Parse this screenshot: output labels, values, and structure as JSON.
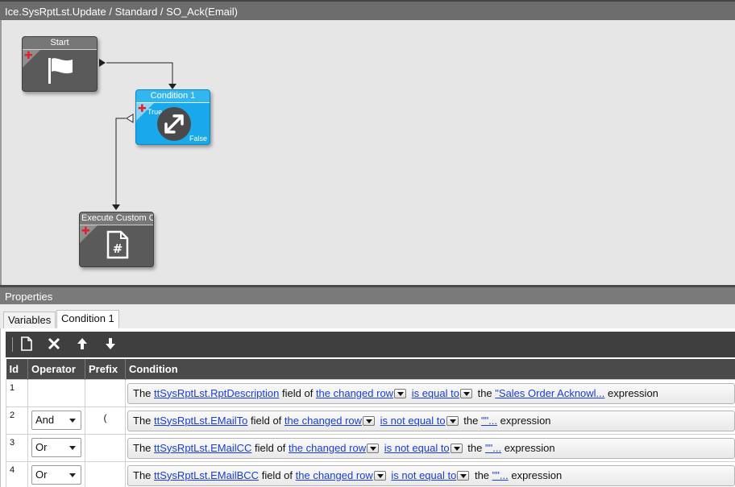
{
  "title": "Ice.SysRptLst.Update / Standard / SO_Ack(Email)",
  "nodes": {
    "start": {
      "label": "Start",
      "icon": "flag-icon"
    },
    "condition": {
      "label": "Condition 1",
      "true_label": "True",
      "false_label": "False",
      "icon": "condition-arrows-icon"
    },
    "custom": {
      "label": "Execute Custom Co",
      "icon": "code-file-icon"
    }
  },
  "properties_title": "Properties",
  "tabs": [
    {
      "label": "Variables"
    },
    {
      "label": "Condition 1"
    }
  ],
  "toolbar": {
    "new_icon": "new-document-icon",
    "delete_icon": "delete-x-icon",
    "up_icon": "arrow-up-icon",
    "down_icon": "arrow-down-icon"
  },
  "grid": {
    "headers": {
      "id": "Id",
      "operator": "Operator",
      "prefix": "Prefix",
      "condition": "Condition"
    },
    "rows": [
      {
        "id": "1",
        "operator": "",
        "prefix": "",
        "t1": "The",
        "field": "ttSysRptLst.RptDescription",
        "t2": "field of",
        "row": "the changed row",
        "op": "is equal to",
        "t3": "the",
        "value": "\"Sales Order Acknowl...",
        "t4": "expression"
      },
      {
        "id": "2",
        "operator": "And",
        "prefix": "(",
        "t1": "The",
        "field": "ttSysRptLst.EMailTo",
        "t2": "field of",
        "row": "the changed row",
        "op": "is not equal to",
        "t3": "the",
        "value": "\"\"...",
        "t4": "expression"
      },
      {
        "id": "3",
        "operator": "Or",
        "prefix": "",
        "t1": "The",
        "field": "ttSysRptLst.EMailCC",
        "t2": "field of",
        "row": "the changed row",
        "op": "is not equal to",
        "t3": "the",
        "value": "\"\"...",
        "t4": "expression"
      },
      {
        "id": "4",
        "operator": "Or",
        "prefix": "",
        "t1": "The",
        "field": "ttSysRptLst.EMailBCC",
        "t2": "field of",
        "row": "the changed row",
        "op": "is not equal to",
        "t3": "the",
        "value": "\"\"...",
        "t4": "expression"
      }
    ]
  },
  "colors": {
    "condition_node": "#19a9ea",
    "gray_node": "#5a5a5a",
    "link": "#1a3fcf",
    "header": "#4a4a4a"
  }
}
